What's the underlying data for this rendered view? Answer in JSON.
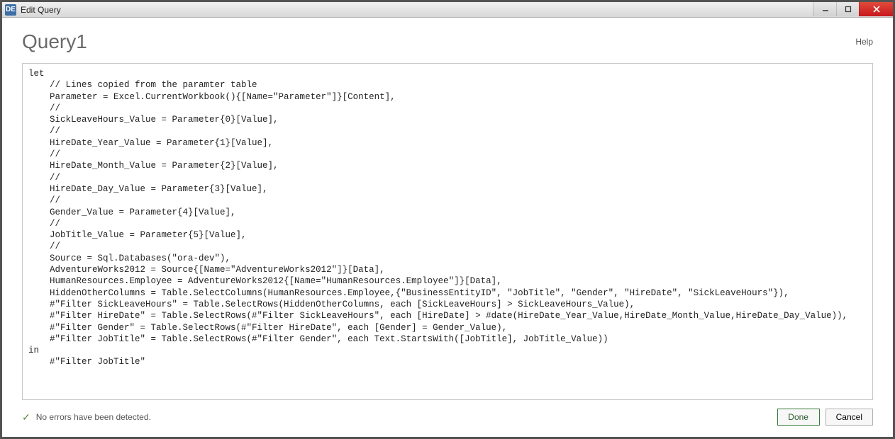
{
  "window": {
    "icon_label": "DE",
    "title": "Edit Query"
  },
  "header": {
    "title": "Query1",
    "help": "Help"
  },
  "editor": {
    "code": "let\n    // Lines copied from the paramter table\n    Parameter = Excel.CurrentWorkbook(){[Name=\"Parameter\"]}[Content],\n    //\n    SickLeaveHours_Value = Parameter{0}[Value],\n    //\n    HireDate_Year_Value = Parameter{1}[Value],\n    //\n    HireDate_Month_Value = Parameter{2}[Value],\n    //\n    HireDate_Day_Value = Parameter{3}[Value],\n    //\n    Gender_Value = Parameter{4}[Value],\n    //\n    JobTitle_Value = Parameter{5}[Value],\n    //\n    Source = Sql.Databases(\"ora-dev\"),\n    AdventureWorks2012 = Source{[Name=\"AdventureWorks2012\"]}[Data],\n    HumanResources.Employee = AdventureWorks2012{[Name=\"HumanResources.Employee\"]}[Data],\n    HiddenOtherColumns = Table.SelectColumns(HumanResources.Employee,{\"BusinessEntityID\", \"JobTitle\", \"Gender\", \"HireDate\", \"SickLeaveHours\"}),\n    #\"Filter SickLeaveHours\" = Table.SelectRows(HiddenOtherColumns, each [SickLeaveHours] > SickLeaveHours_Value),\n    #\"Filter HireDate\" = Table.SelectRows(#\"Filter SickLeaveHours\", each [HireDate] > #date(HireDate_Year_Value,HireDate_Month_Value,HireDate_Day_Value)),\n    #\"Filter Gender\" = Table.SelectRows(#\"Filter HireDate\", each [Gender] = Gender_Value),\n    #\"Filter JobTitle\" = Table.SelectRows(#\"Filter Gender\", each Text.StartsWith([JobTitle], JobTitle_Value))\nin\n    #\"Filter JobTitle\""
  },
  "status": {
    "message": "No errors have been detected."
  },
  "buttons": {
    "done": "Done",
    "cancel": "Cancel"
  }
}
